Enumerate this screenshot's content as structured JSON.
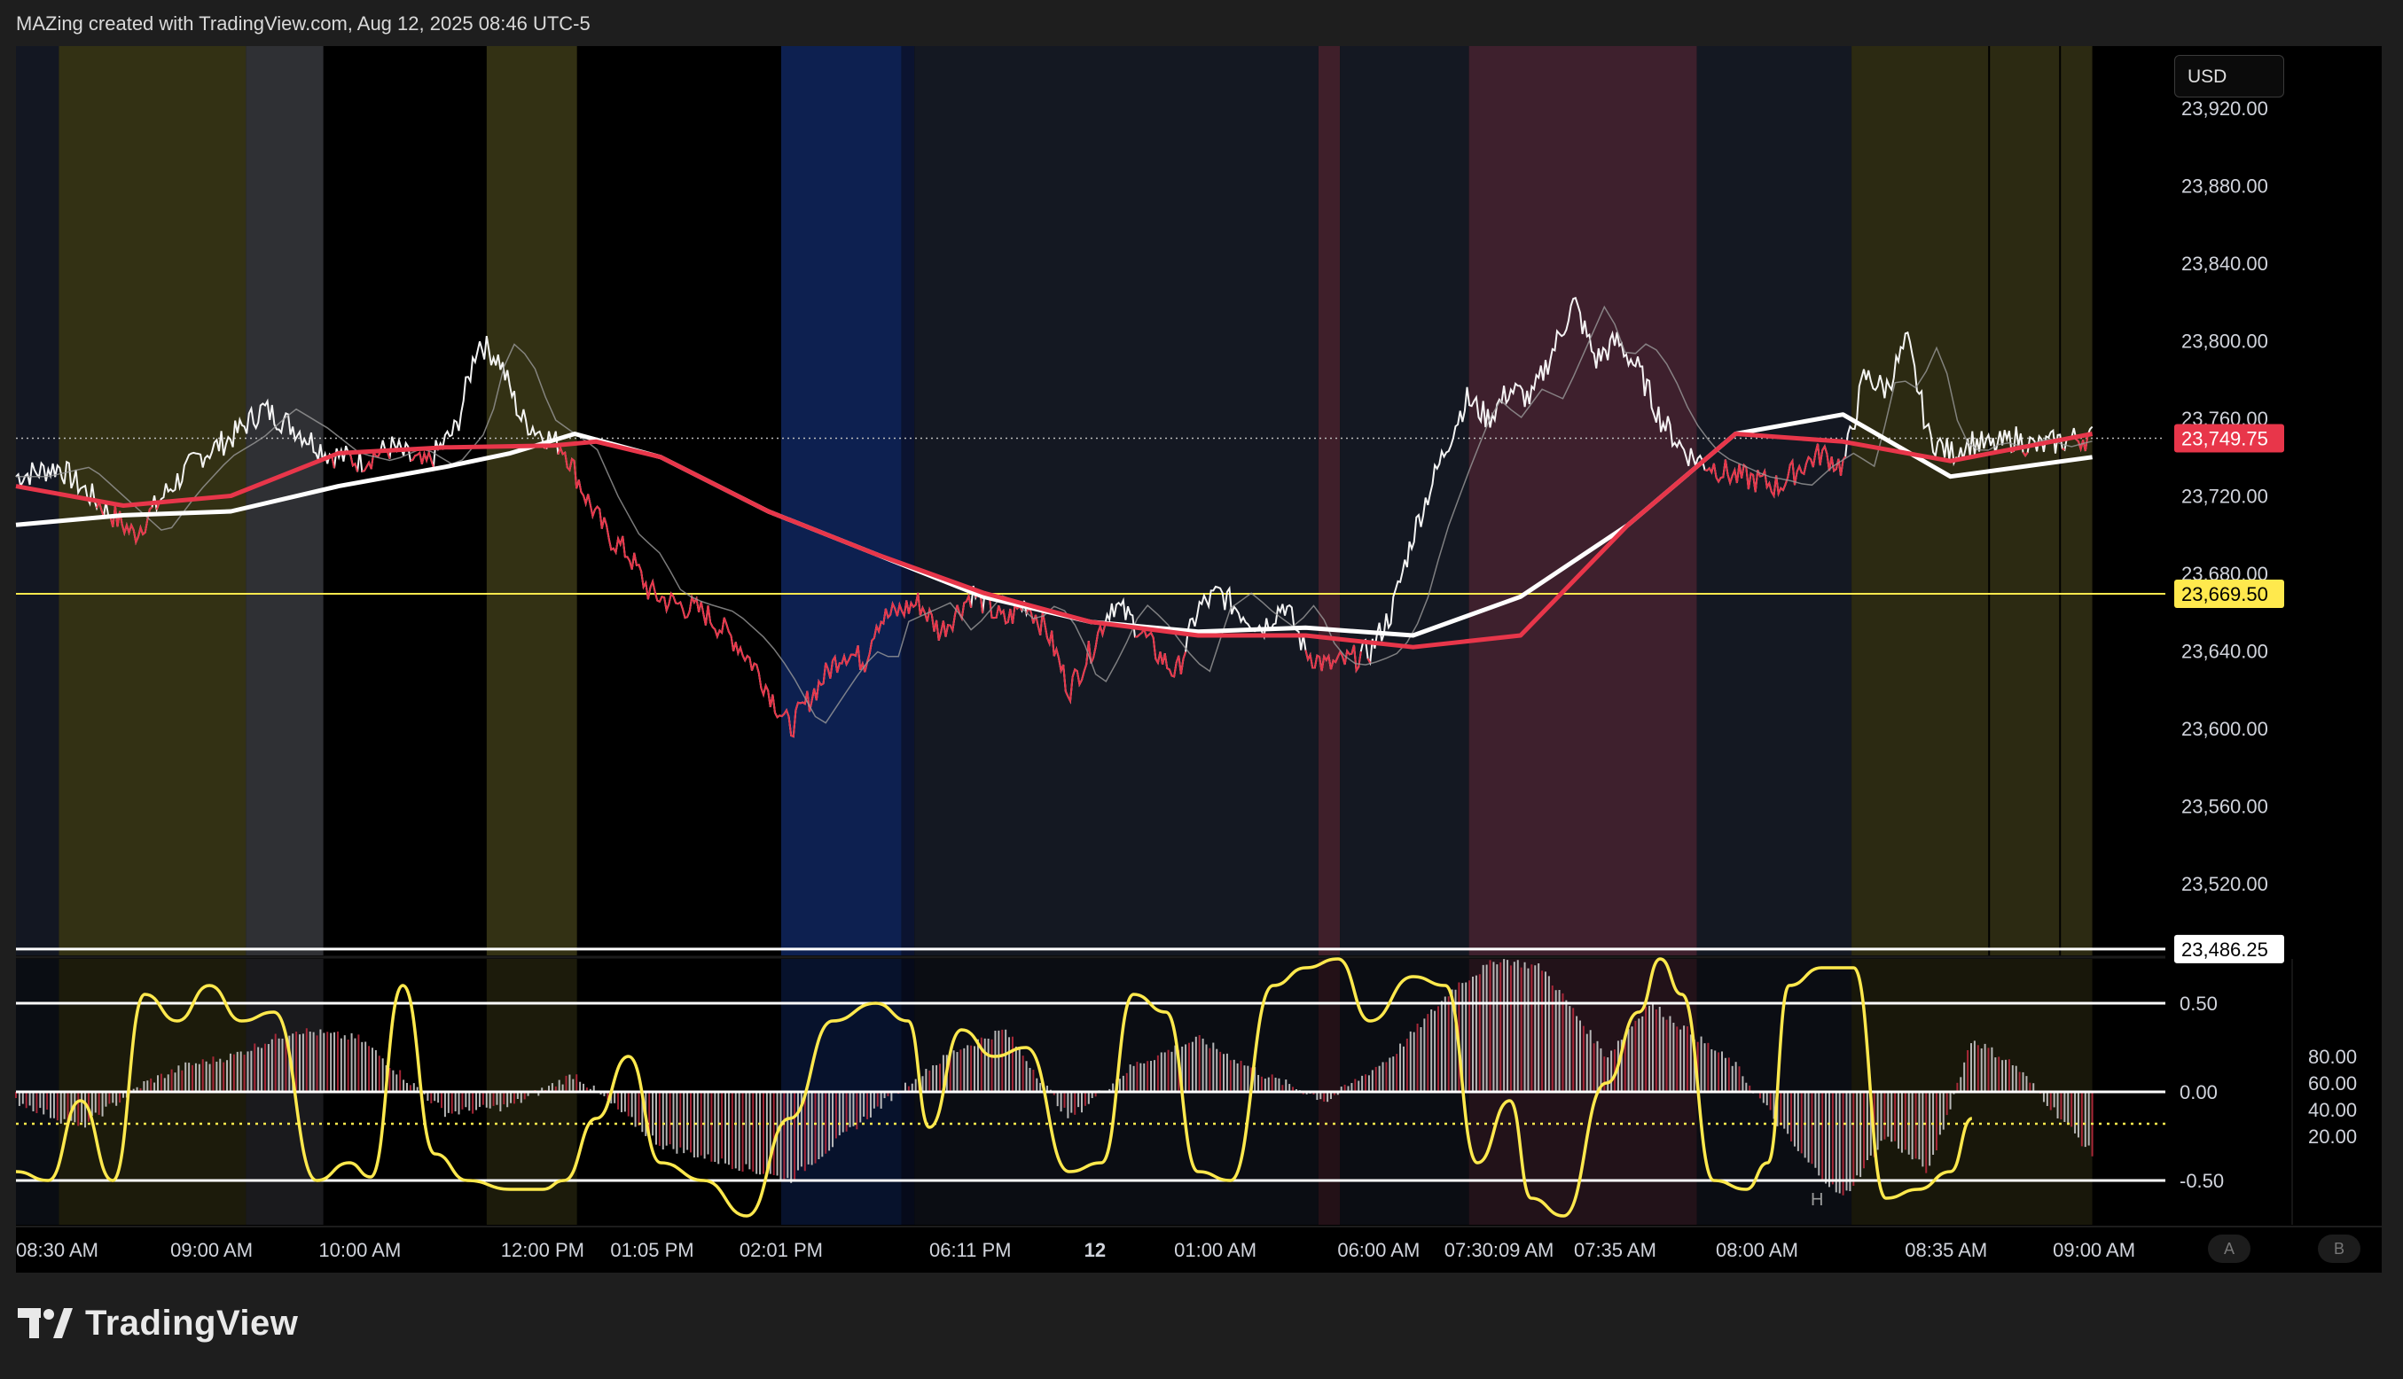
{
  "header": {
    "credit": "MAZing created with TradingView.com, Aug 12, 2025 08:46 UTC-5"
  },
  "brand": {
    "name": "TradingView"
  },
  "currency": "USD",
  "buttons": {
    "a": "A",
    "b": "B"
  },
  "chart_data": [
    {
      "type": "line",
      "panel": "price",
      "y_ticks": [
        "23,920.00",
        "23,880.00",
        "23,840.00",
        "23,800.00",
        "23,760.00",
        "23,720.00",
        "23,680.00",
        "23,640.00",
        "23,600.00",
        "23,560.00",
        "23,520.00"
      ],
      "ylim": [
        23483,
        23952
      ],
      "x_labels": [
        "08:30 AM",
        "09:00 AM",
        "10:00 AM",
        "12:00 PM",
        "01:05 PM",
        "02:01 PM",
        "06:11 PM",
        "12",
        "01:00 AM",
        "06:00 AM",
        "07:30:09 AM",
        "07:35 AM",
        "08:00 AM",
        "08:35 AM",
        "09:00 AM"
      ],
      "last_price": {
        "label": "23,749.75",
        "value": 23749.75,
        "color": "#e8364a"
      },
      "hline_yellow": {
        "label": "23,669.50",
        "value": 23669.5,
        "color": "#ffe94d"
      },
      "hline_white": {
        "label": "23,486.25",
        "value": 23486.25,
        "color": "#ffffff"
      },
      "session_shading": [
        {
          "from": 0.0,
          "to": 0.02,
          "color": "#131722"
        },
        {
          "from": 0.02,
          "to": 0.107,
          "color": "#333114"
        },
        {
          "from": 0.107,
          "to": 0.143,
          "color": "#2f3034"
        },
        {
          "from": 0.219,
          "to": 0.261,
          "color": "#333114"
        },
        {
          "from": 0.356,
          "to": 0.412,
          "color": "#0d2050"
        },
        {
          "from": 0.412,
          "to": 0.418,
          "color": "#0b1330"
        },
        {
          "from": 0.418,
          "to": 0.606,
          "color": "#141822"
        },
        {
          "from": 0.606,
          "to": 0.616,
          "color": "#3f1f2a"
        },
        {
          "from": 0.616,
          "to": 0.676,
          "color": "#141822"
        },
        {
          "from": 0.676,
          "to": 0.782,
          "color": "#3e202d"
        },
        {
          "from": 0.782,
          "to": 0.854,
          "color": "#141822"
        },
        {
          "from": 0.854,
          "to": 0.966,
          "color": "#2c2a12"
        }
      ],
      "series": [
        {
          "name": "",
          "color": "#ffffff",
          "role": "price",
          "x": [
            0.0,
            0.02,
            0.04,
            0.055,
            0.07,
            0.085,
            0.1,
            0.115,
            0.13,
            0.145,
            0.16,
            0.175,
            0.19,
            0.205,
            0.215,
            0.225,
            0.235,
            0.245,
            0.255,
            0.265,
            0.275,
            0.285,
            0.295,
            0.305,
            0.32,
            0.335,
            0.345,
            0.36,
            0.375,
            0.385,
            0.395,
            0.4,
            0.41,
            0.42,
            0.43,
            0.445,
            0.46,
            0.47,
            0.48,
            0.49,
            0.5,
            0.51,
            0.52,
            0.53,
            0.54,
            0.55,
            0.56,
            0.57,
            0.58,
            0.59,
            0.6,
            0.61,
            0.62,
            0.63,
            0.64,
            0.65,
            0.66,
            0.67,
            0.675,
            0.685,
            0.695,
            0.705,
            0.715,
            0.725,
            0.735,
            0.745,
            0.755,
            0.765,
            0.775,
            0.78,
            0.79,
            0.8,
            0.81,
            0.82,
            0.83,
            0.84,
            0.85,
            0.86,
            0.87,
            0.88,
            0.89,
            0.9,
            0.91,
            0.92,
            0.93,
            0.94,
            0.95,
            0.96,
            0.966
          ],
          "y": [
            23730,
            23735,
            23715,
            23700,
            23722,
            23740,
            23750,
            23765,
            23755,
            23742,
            23738,
            23745,
            23735,
            23755,
            23800,
            23790,
            23760,
            23752,
            23745,
            23720,
            23700,
            23690,
            23670,
            23665,
            23660,
            23645,
            23630,
            23600,
            23625,
            23640,
            23635,
            23655,
            23660,
            23665,
            23650,
            23670,
            23655,
            23665,
            23650,
            23620,
            23640,
            23665,
            23655,
            23640,
            23628,
            23662,
            23670,
            23660,
            23652,
            23665,
            23640,
            23632,
            23635,
            23640,
            23660,
            23700,
            23730,
            23758,
            23770,
            23760,
            23775,
            23770,
            23795,
            23820,
            23790,
            23800,
            23785,
            23760,
            23745,
            23740,
            23735,
            23730,
            23728,
            23725,
            23735,
            23742,
            23735,
            23782,
            23775,
            23800,
            23750,
            23742,
            23748,
            23745,
            23750,
            23745,
            23748,
            23750,
            23750
          ]
        },
        {
          "name": "",
          "color": "#e8364a",
          "role": "ma-slow",
          "x": [
            0.0,
            0.05,
            0.1,
            0.15,
            0.2,
            0.25,
            0.27,
            0.3,
            0.35,
            0.4,
            0.45,
            0.5,
            0.55,
            0.6,
            0.65,
            0.7,
            0.75,
            0.8,
            0.85,
            0.9,
            0.966
          ],
          "y": [
            23725,
            23715,
            23720,
            23742,
            23745,
            23746,
            23748,
            23740,
            23712,
            23690,
            23670,
            23655,
            23648,
            23648,
            23642,
            23648,
            23705,
            23752,
            23748,
            23738,
            23752
          ]
        },
        {
          "name": "",
          "color": "#ffffff",
          "role": "ma-fast",
          "x": [
            0.0,
            0.05,
            0.1,
            0.15,
            0.2,
            0.23,
            0.26,
            0.3,
            0.35,
            0.4,
            0.45,
            0.5,
            0.55,
            0.6,
            0.65,
            0.7,
            0.75,
            0.8,
            0.85,
            0.9,
            0.966
          ],
          "y": [
            23705,
            23710,
            23712,
            23725,
            23735,
            23742,
            23752,
            23740,
            23712,
            23690,
            23668,
            23655,
            23650,
            23652,
            23648,
            23668,
            23705,
            23752,
            23762,
            23730,
            23740
          ]
        }
      ]
    },
    {
      "type": "line",
      "panel": "oscillator",
      "y_ticks_left": [
        "0.50",
        "0.00",
        "-0.50"
      ],
      "y_ticks_right": [
        "80.00",
        "60.00",
        "40.00",
        "20.00"
      ],
      "ylim": [
        -0.75,
        0.75
      ],
      "hlines": [
        0.5,
        0.0,
        -0.5
      ],
      "dotted_level": -0.18,
      "marker": "H",
      "histogram": {
        "x": [
          0.0,
          0.03,
          0.06,
          0.08,
          0.1,
          0.13,
          0.16,
          0.2,
          0.23,
          0.26,
          0.3,
          0.33,
          0.36,
          0.39,
          0.42,
          0.44,
          0.46,
          0.49,
          0.52,
          0.55,
          0.58,
          0.61,
          0.64,
          0.67,
          0.69,
          0.71,
          0.74,
          0.76,
          0.8,
          0.83,
          0.85,
          0.87,
          0.89,
          0.91,
          0.93,
          0.966
        ],
        "y": [
          -0.05,
          -0.2,
          0.05,
          0.15,
          0.2,
          0.35,
          0.3,
          -0.12,
          -0.08,
          0.1,
          -0.3,
          -0.4,
          -0.5,
          -0.2,
          0.1,
          0.25,
          0.35,
          -0.15,
          0.15,
          0.3,
          0.1,
          -0.05,
          0.2,
          0.6,
          0.75,
          0.7,
          0.2,
          0.5,
          0.15,
          -0.35,
          -0.6,
          -0.25,
          -0.45,
          0.3,
          0.15,
          -0.35
        ]
      },
      "signal": {
        "x": [
          0.0,
          0.015,
          0.03,
          0.045,
          0.06,
          0.075,
          0.09,
          0.105,
          0.12,
          0.14,
          0.155,
          0.165,
          0.18,
          0.195,
          0.21,
          0.23,
          0.245,
          0.255,
          0.27,
          0.285,
          0.3,
          0.32,
          0.34,
          0.36,
          0.38,
          0.4,
          0.415,
          0.425,
          0.44,
          0.455,
          0.47,
          0.49,
          0.505,
          0.52,
          0.535,
          0.55,
          0.565,
          0.585,
          0.6,
          0.615,
          0.63,
          0.65,
          0.665,
          0.68,
          0.695,
          0.705,
          0.72,
          0.74,
          0.755,
          0.765,
          0.775,
          0.79,
          0.805,
          0.815,
          0.825,
          0.84,
          0.855,
          0.87,
          0.885,
          0.9,
          0.91,
          0.925,
          0.94,
          0.955,
          0.966
        ],
        "y": [
          -0.45,
          -0.5,
          -0.05,
          -0.5,
          0.55,
          0.4,
          0.6,
          0.4,
          0.45,
          -0.5,
          -0.4,
          -0.48,
          0.6,
          -0.35,
          -0.5,
          -0.55,
          -0.55,
          -0.5,
          -0.15,
          0.2,
          -0.4,
          -0.5,
          -0.7,
          -0.15,
          0.4,
          0.5,
          0.4,
          -0.2,
          0.35,
          0.2,
          0.25,
          -0.45,
          -0.4,
          0.55,
          0.45,
          -0.45,
          -0.5,
          0.6,
          0.7,
          0.75,
          0.4,
          0.65,
          0.6,
          -0.4,
          -0.05,
          -0.6,
          -0.7,
          0.05,
          0.45,
          0.75,
          0.55,
          -0.5,
          -0.55,
          -0.4,
          0.6,
          0.7,
          0.7,
          -0.6,
          -0.55,
          -0.45,
          -0.15
        ]
      }
    }
  ]
}
